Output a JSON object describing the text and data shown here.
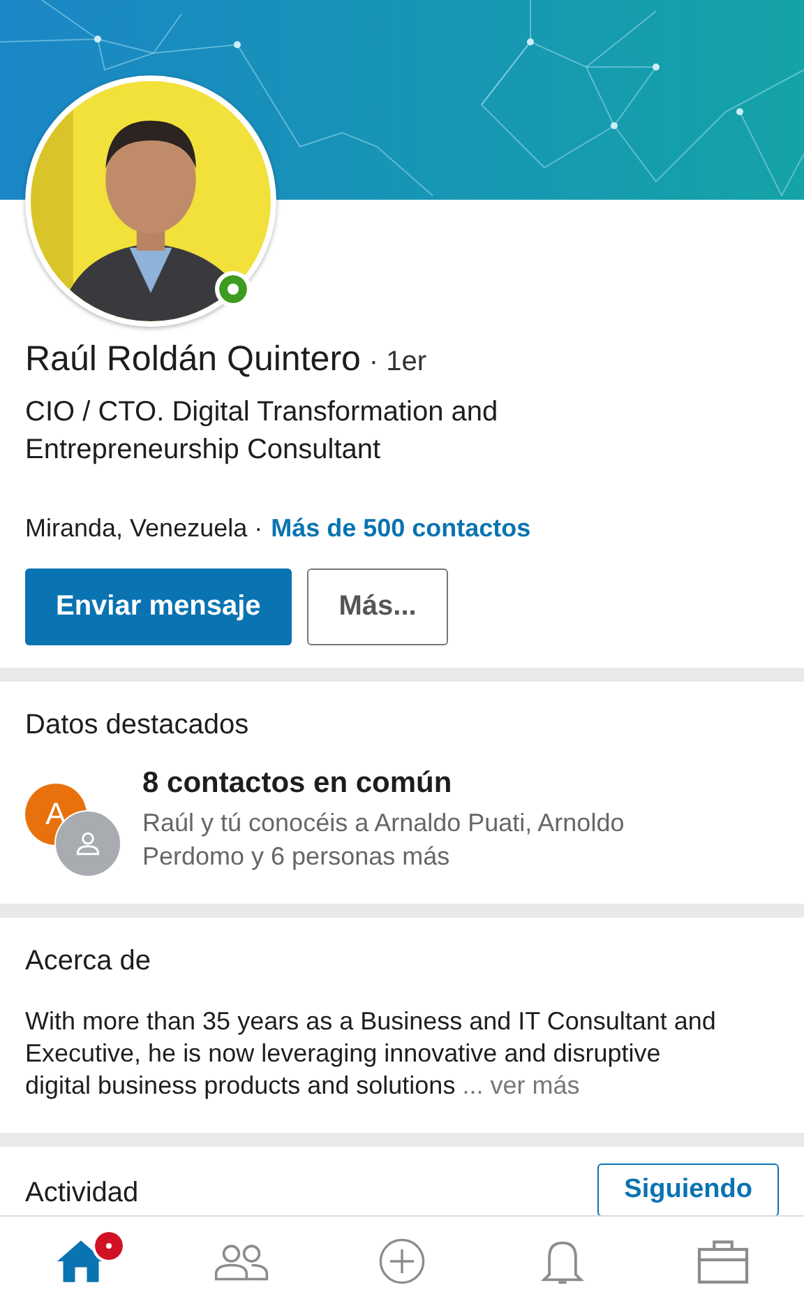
{
  "profile": {
    "online": true,
    "name": "Raúl Roldán Quintero",
    "degree": "· 1er",
    "headline": "CIO / CTO. Digital Transformation and Entrepreneurship Consultant",
    "location": "Miranda, Venezuela ·",
    "connections": "Más de 500 contactos",
    "buttons": [
      {
        "label": "Enviar mensaje",
        "kind": "primary"
      },
      {
        "label": "Más...",
        "kind": "secondary"
      }
    ]
  },
  "highlights": {
    "title": "Datos destacados",
    "avatar_initial": "A",
    "heading": "8 contactos en común",
    "text": "Raúl y tú conocéis a Arnaldo Puati, Arnoldo Perdomo y 6 personas más"
  },
  "about": {
    "title": "Acerca de",
    "text": "With more than 35 years as a Business and IT Consultant and Executive, he is now leveraging innovative and disruptive digital business products and solutions",
    "more": "... ver más"
  },
  "activity": {
    "title": "Actividad",
    "button": "Siguiendo"
  },
  "nav": [
    {
      "kind": "home",
      "selected": true,
      "badge": true
    },
    {
      "kind": "network",
      "selected": false,
      "badge": false
    },
    {
      "kind": "post",
      "selected": false,
      "badge": false
    },
    {
      "kind": "notifications",
      "selected": false,
      "badge": false
    },
    {
      "kind": "jobs",
      "selected": false,
      "badge": false
    }
  ]
}
